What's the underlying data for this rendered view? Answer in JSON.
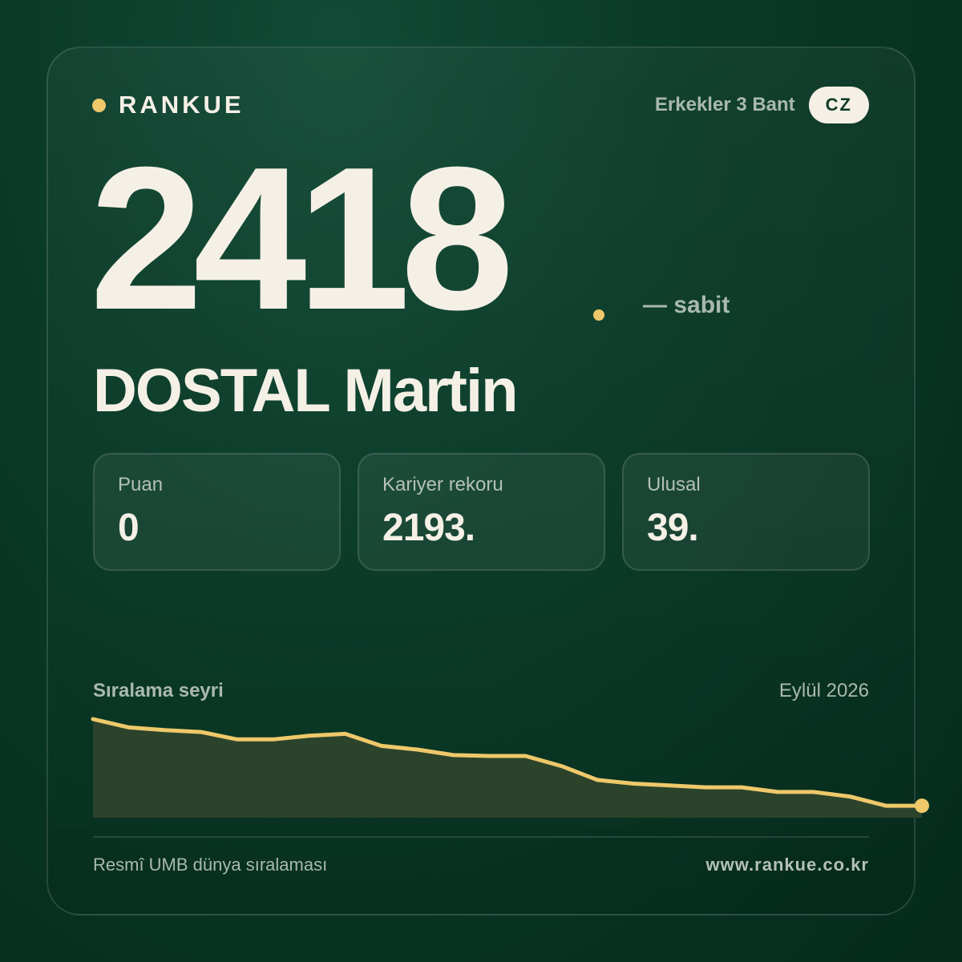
{
  "brand": {
    "name": "RANKUE",
    "dot_color": "#eec86a"
  },
  "header": {
    "category": "Erkekler 3 Bant",
    "country_code": "CZ"
  },
  "rank": {
    "number": "2418",
    "change": "— sabit"
  },
  "player": {
    "name": "DOSTAL Martin"
  },
  "stats": [
    {
      "label": "Puan",
      "value": "0"
    },
    {
      "label": "Kariyer rekoru",
      "value": "2193."
    },
    {
      "label": "Ulusal",
      "value": "39."
    }
  ],
  "trend": {
    "title": "Sıralama seyri",
    "date": "Eylül 2026"
  },
  "chart_data": {
    "type": "area",
    "title": "Sıralama seyri",
    "xlabel": "",
    "ylabel": "",
    "grid": false,
    "legend": "none",
    "line_color": "#eec86a",
    "fill_color": "#2c432b",
    "x": [
      1,
      2,
      3,
      4,
      5,
      6,
      7,
      8,
      9,
      10,
      11,
      12,
      13,
      14,
      15,
      16,
      17,
      18,
      19,
      20,
      21,
      22,
      23,
      24
    ],
    "y_relative": [
      100,
      91,
      88,
      86,
      78,
      78,
      82,
      84,
      71,
      67,
      61,
      60,
      60,
      49,
      34,
      30,
      28,
      26,
      26,
      21,
      21,
      16,
      6,
      6
    ],
    "ylim": [
      0,
      100
    ]
  },
  "footer": {
    "source": "Resmî UMB dünya sıralaması",
    "url": "www.rankue.co.kr"
  }
}
